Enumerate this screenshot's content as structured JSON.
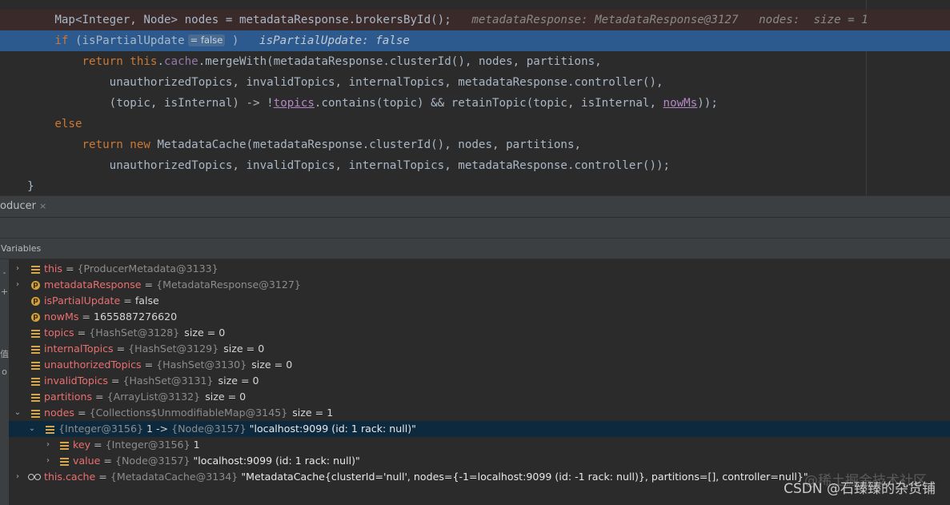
{
  "editor": {
    "lines": [
      {
        "indent": "        ",
        "map_decl": "Map<Integer, Node> nodes = metadataResponse.brokersById();",
        "hint": "metadataResponse: MetadataResponse@3127   nodes:  size = 1"
      },
      {
        "indent": "        ",
        "kw": "if",
        "cond": " (isPartialUpdate",
        "inlay": "= false",
        "close": " )",
        "hint": "isPartialUpdate: false"
      },
      {
        "indent": "            ",
        "kw_return": "return",
        "kw_this": " this",
        "dot": ".",
        "field": "cache",
        "rest": ".mergeWith(metadataResponse.clusterId(), nodes, partitions,"
      },
      {
        "indent": "                ",
        "text": "unauthorizedTopics, invalidTopics, internalTopics, metadataResponse.controller(),"
      },
      {
        "indent": "                ",
        "pre": "(topic, isInternal) -> !",
        "topics_ref": "topics",
        "mid": ".contains(topic) && retainTopic(topic, isInternal, ",
        "nowms_ref": "nowMs",
        "post": "));"
      },
      {
        "indent": "        ",
        "kw": "else"
      },
      {
        "indent": "            ",
        "kw_return": "return",
        "kw_new": " new",
        "rest": " MetadataCache(metadataResponse.clusterId(), nodes, partitions,"
      },
      {
        "indent": "                ",
        "text": "unauthorizedTopics, invalidTopics, internalTopics, metadataResponse.controller());"
      },
      {
        "indent": "    ",
        "text": "}"
      }
    ]
  },
  "debug": {
    "tab_label": "oducer",
    "tab_close": "×",
    "panel_title": "Variables",
    "strip_glyphs": [
      "-",
      "+",
      "值",
      "o"
    ],
    "variables": [
      {
        "arrow": "›",
        "icon": "field",
        "name": "this",
        "eq": " = ",
        "ref": "{ProducerMetadata@3133}",
        "value": "",
        "size": ""
      },
      {
        "arrow": "›",
        "icon": "param",
        "name": "metadataResponse",
        "eq": " = ",
        "ref": "{MetadataResponse@3127}",
        "value": "",
        "size": ""
      },
      {
        "arrow": "",
        "icon": "param",
        "name": "isPartialUpdate",
        "eq": " = ",
        "ref": "",
        "value": "false",
        "size": ""
      },
      {
        "arrow": "",
        "icon": "param",
        "name": "nowMs",
        "eq": " = ",
        "ref": "",
        "value": "1655887276620",
        "size": ""
      },
      {
        "arrow": "",
        "icon": "field",
        "name": "topics",
        "eq": " = ",
        "ref": "{HashSet@3128}",
        "value": "",
        "size": "size = 0"
      },
      {
        "arrow": "",
        "icon": "field",
        "name": "internalTopics",
        "eq": " = ",
        "ref": "{HashSet@3129}",
        "value": "",
        "size": "size = 0"
      },
      {
        "arrow": "",
        "icon": "field",
        "name": "unauthorizedTopics",
        "eq": " = ",
        "ref": "{HashSet@3130}",
        "value": "",
        "size": "size = 0"
      },
      {
        "arrow": "",
        "icon": "field",
        "name": "invalidTopics",
        "eq": " = ",
        "ref": "{HashSet@3131}",
        "value": "",
        "size": "size = 0"
      },
      {
        "arrow": "",
        "icon": "field",
        "name": "partitions",
        "eq": " = ",
        "ref": "{ArrayList@3132}",
        "value": "",
        "size": "size = 0"
      },
      {
        "arrow": "⌄",
        "icon": "field",
        "name": "nodes",
        "eq": " = ",
        "ref": "{Collections$UnmodifiableMap@3145}",
        "value": "",
        "size": "size = 1"
      }
    ],
    "entry": {
      "arrow": "⌄",
      "key_ref": "{Integer@3156}",
      "key_val": " 1 -> ",
      "val_ref": "{Node@3157}",
      "val_str": " \"localhost:9099 (id: 1 rack: null)\""
    },
    "entry_children": [
      {
        "arrow": "›",
        "name": "key",
        "eq": " = ",
        "ref": "{Integer@3156}",
        "value": " 1"
      },
      {
        "arrow": "›",
        "name": "value",
        "eq": " = ",
        "ref": "{Node@3157}",
        "value": " \"localhost:9099 (id: 1 rack: null)\""
      }
    ],
    "cache_row": {
      "arrow": "›",
      "name": "this.cache",
      "eq": " = ",
      "ref": "{MetadataCache@3134}",
      "value": " \"MetadataCache{clusterId='null', nodes={-1=localhost:9099 (id: -1 rack: null)}, partitions=[], controller=null}\""
    }
  },
  "watermark": {
    "text": "CSDN @石臻臻的杂货铺",
    "text_behind": "@稀土掘金技术社区"
  }
}
